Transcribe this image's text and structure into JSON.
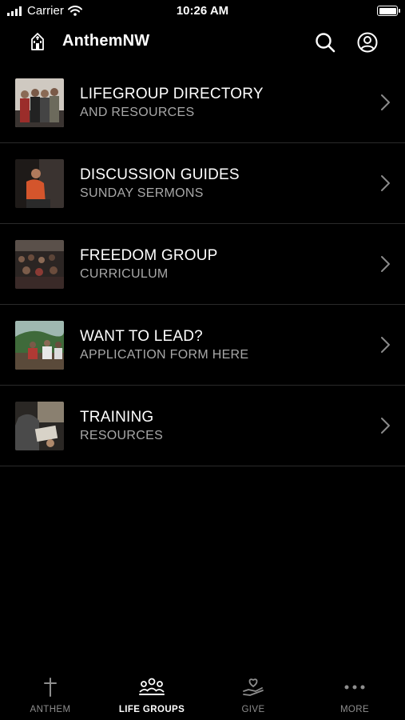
{
  "status_bar": {
    "carrier": "Carrier",
    "time": "10:26 AM"
  },
  "header": {
    "app_name": "AnthemNW",
    "icons": [
      "church-logo-icon",
      "search-icon",
      "account-icon"
    ]
  },
  "items": [
    {
      "title": "LIFEGROUP DIRECTORY",
      "subtitle": "AND RESOURCES",
      "thumbnail": "group-photo"
    },
    {
      "title": "DISCUSSION GUIDES",
      "subtitle": "SUNDAY SERMONS",
      "thumbnail": "speaker-photo"
    },
    {
      "title": "FREEDOM GROUP",
      "subtitle": "CURRICULUM",
      "thumbnail": "crowd-photo"
    },
    {
      "title": "WANT TO LEAD?",
      "subtitle": "APPLICATION FORM HERE",
      "thumbnail": "outdoors-photo"
    },
    {
      "title": "TRAINING",
      "subtitle": "RESOURCES",
      "thumbnail": "study-photo"
    }
  ],
  "tabs": [
    {
      "label": "ANTHEM",
      "icon": "cross-icon",
      "active": false
    },
    {
      "label": "LIFE GROUPS",
      "icon": "people-icon",
      "active": true
    },
    {
      "label": "GIVE",
      "icon": "heart-hand-icon",
      "active": false
    },
    {
      "label": "MORE",
      "icon": "ellipsis-icon",
      "active": false
    }
  ],
  "colors": {
    "background": "#000000",
    "text": "#ffffff",
    "subtext": "#a8a8a8",
    "divider": "#2a2a2a",
    "inactive_tab": "#8e8e8e"
  }
}
